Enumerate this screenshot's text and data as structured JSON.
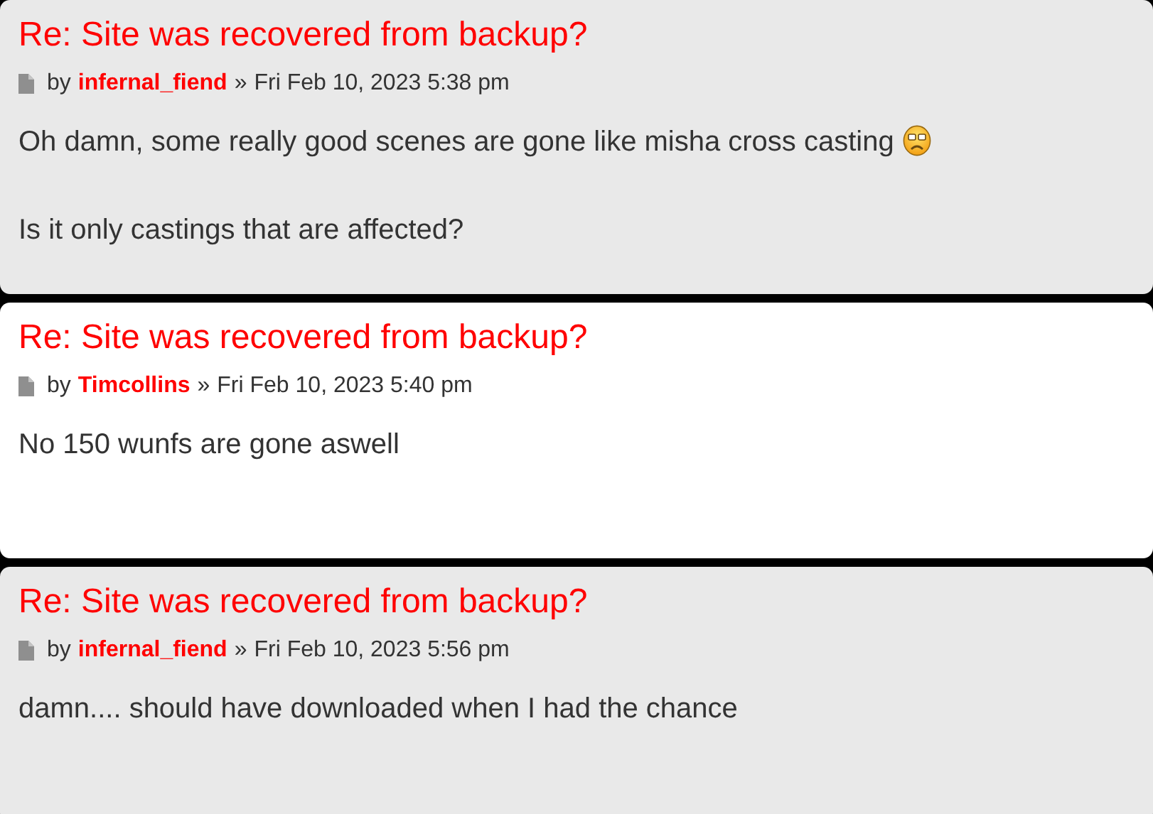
{
  "posts": [
    {
      "color": "#e9e9e9",
      "title": "Re: Site was recovered from backup?",
      "by": "by",
      "author": "infernal_fiend",
      "sep": "»",
      "date": "Fri Feb 10, 2023 5:38 pm",
      "paragraphs": [
        {
          "text": "Oh damn, some really good scenes are gone like misha cross casting",
          "emoji": true
        },
        {
          "text": "Is it only castings that are affected?",
          "emoji": false
        }
      ]
    },
    {
      "color": "#ffffff",
      "title": "Re: Site was recovered from backup?",
      "by": "by",
      "author": "Timcollins",
      "sep": "»",
      "date": "Fri Feb 10, 2023 5:40 pm",
      "paragraphs": [
        {
          "text": "No 150 wunfs are gone aswell",
          "emoji": false
        }
      ]
    },
    {
      "color": "#e9e9e9",
      "title": "Re: Site was recovered from backup?",
      "by": "by",
      "author": "infernal_fiend",
      "sep": "»",
      "date": "Fri Feb 10, 2023 5:56 pm",
      "paragraphs": [
        {
          "text": "damn.... should have downloaded when I had the chance",
          "emoji": false
        }
      ]
    }
  ]
}
